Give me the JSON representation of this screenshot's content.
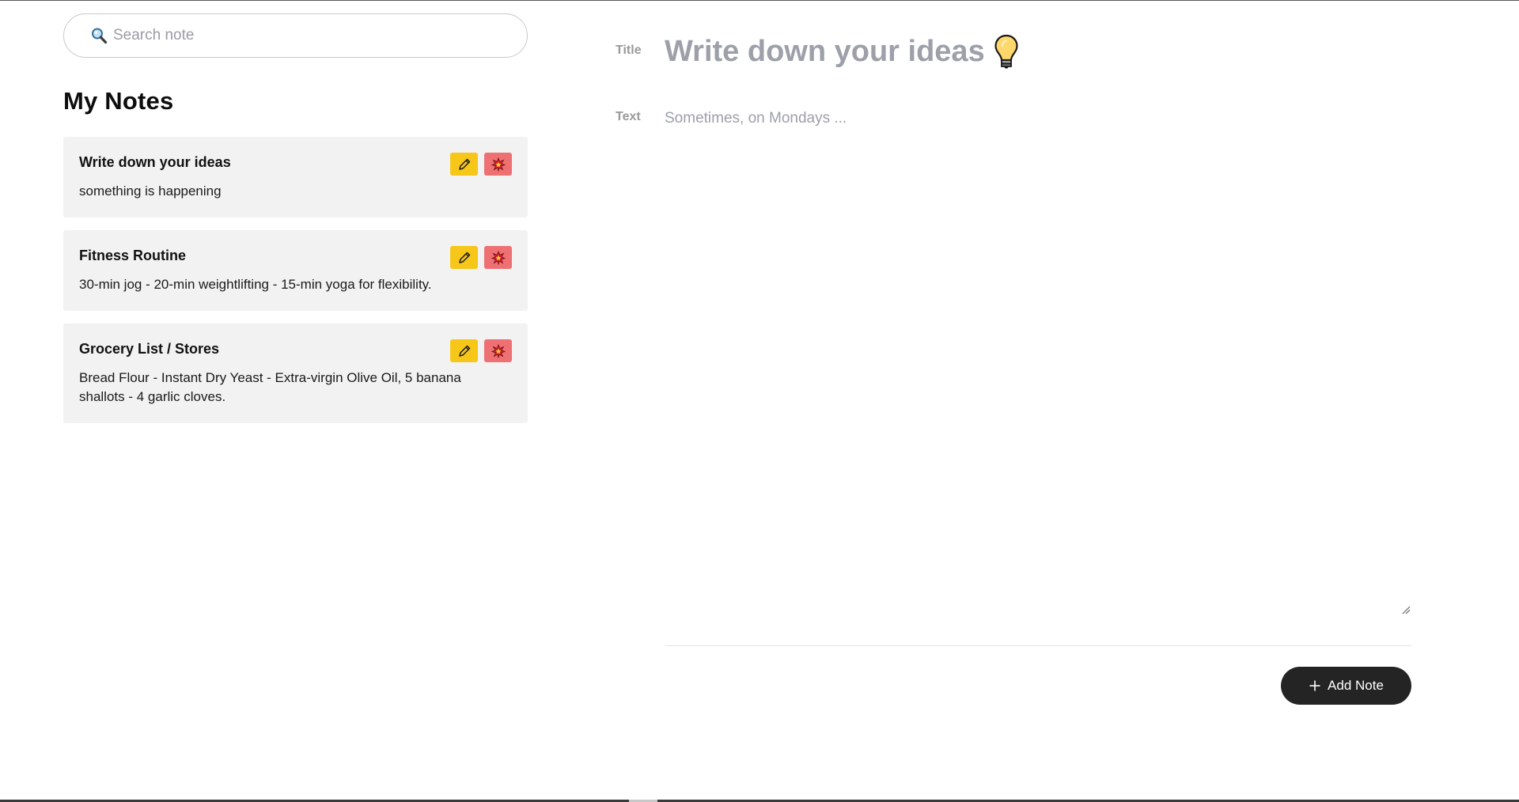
{
  "search": {
    "placeholder": "Search note",
    "icon": "magnifier-icon"
  },
  "notes_panel": {
    "heading": "My Notes",
    "notes": [
      {
        "title": "Write down your ideas",
        "text": "something is happening"
      },
      {
        "title": "Fitness Routine",
        "text": "30-min jog - 20-min weightlifting - 15-min yoga for flexibility."
      },
      {
        "title": "Grocery List / Stores",
        "text": "Bread Flour - Instant Dry Yeast - Extra-virgin Olive Oil, 5 banana shallots - 4 garlic cloves."
      }
    ],
    "edit_icon": "pencil-icon",
    "delete_icon": "collision-icon"
  },
  "editor": {
    "title_label": "Title",
    "title_placeholder": "Write down your ideas",
    "title_icon": "lightbulb-icon",
    "text_label": "Text",
    "text_placeholder": "Sometimes, on Mondays ...",
    "add_button_label": "Add Note",
    "add_button_icon": "plus-icon"
  },
  "colors": {
    "edit_button": "#f6c619",
    "delete_button": "#ee7073",
    "add_button": "#242424",
    "card_background": "#f2f2f2",
    "placeholder": "#9da0a9"
  }
}
